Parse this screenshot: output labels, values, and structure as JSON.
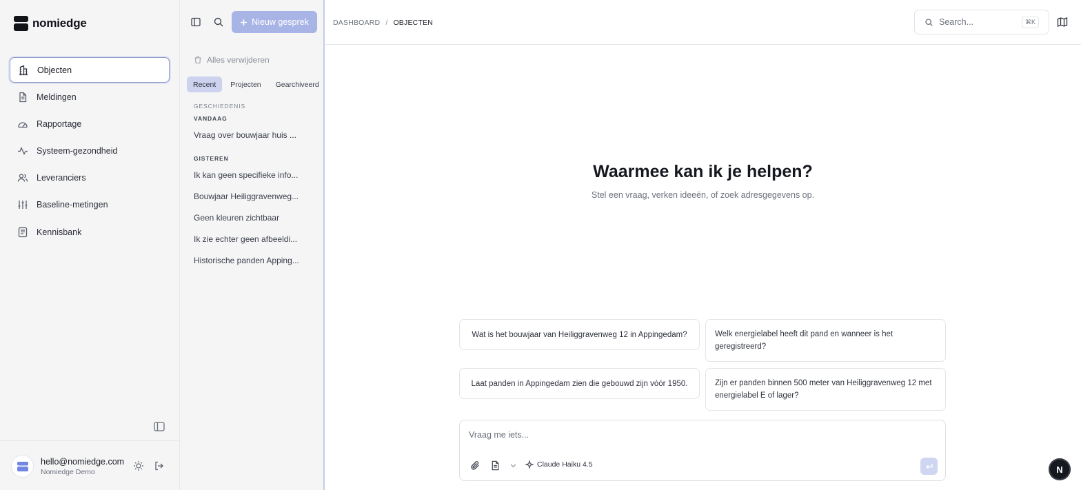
{
  "brand": {
    "name": "nomiedge"
  },
  "sidebar": {
    "items": [
      {
        "label": "Objecten",
        "icon": "building-icon",
        "active": true
      },
      {
        "label": "Meldingen",
        "icon": "document-icon"
      },
      {
        "label": "Rapportage",
        "icon": "gauge-icon"
      },
      {
        "label": "Systeem-gezondheid",
        "icon": "activity-icon"
      },
      {
        "label": "Leveranciers",
        "icon": "users-icon"
      },
      {
        "label": "Baseline-metingen",
        "icon": "sliders-icon"
      },
      {
        "label": "Kennisbank",
        "icon": "book-icon"
      }
    ]
  },
  "user": {
    "email": "hello@nomiedge.com",
    "org": "Nomiedge Demo"
  },
  "history": {
    "new_chat_label": "Nieuw gesprek",
    "delete_all_label": "Alles verwijderen",
    "tabs": [
      "Recent",
      "Projecten",
      "Gearchiveerd"
    ],
    "section_title": "GESCHIEDENIS",
    "groups": [
      {
        "title": "VANDAAG",
        "items": [
          "Vraag over bouwjaar huis ..."
        ]
      },
      {
        "title": "GISTEREN",
        "items": [
          "Ik kan geen specifieke info...",
          "Bouwjaar Heiliggravenweg...",
          "Geen kleuren zichtbaar",
          "Ik zie echter geen afbeeldi...",
          "Historische panden Apping..."
        ]
      }
    ]
  },
  "topbar": {
    "breadcrumb": [
      "DASHBOARD",
      "OBJECTEN"
    ],
    "breadcrumb_sep": "/",
    "search_placeholder": "Search...",
    "search_shortcut": "⌘K"
  },
  "main": {
    "title": "Waarmee kan ik je helpen?",
    "subtitle": "Stel een vraag, verken ideeën, of zoek adresgegevens op.",
    "suggestions": [
      "Wat is het bouwjaar van Heiliggravenweg 12 in Appingedam?",
      "Welk energielabel heeft dit pand en wanneer is het geregistreerd?",
      "Laat panden in Appingedam zien die gebouwd zijn vóór 1950.",
      "Zijn er panden binnen 500 meter van Heiliggravenweg 12 met energielabel E of lager?"
    ],
    "composer_placeholder": "Vraag me iets...",
    "model_label": "Claude Haiku 4.5"
  },
  "badge": {
    "letter": "N"
  },
  "colors": {
    "accent": "#a9b4e6",
    "active_tab": "#cdd3ef",
    "active_border": "#8f97c8"
  }
}
